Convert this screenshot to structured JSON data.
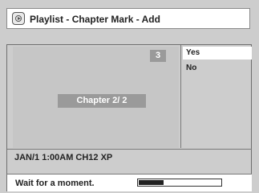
{
  "header": {
    "title": "Playlist - Chapter Mark - Add",
    "icon": "disc-icon"
  },
  "preview": {
    "count": "3",
    "chapter_text": "Chapter    2/ 2"
  },
  "menu": {
    "items": [
      {
        "label": "Yes",
        "selected": true
      },
      {
        "label": "No",
        "selected": false
      }
    ]
  },
  "info": {
    "line": "JAN/1 1:00AM CH12 XP"
  },
  "status": {
    "message": "Wait for a moment.",
    "progress": 0.3
  }
}
